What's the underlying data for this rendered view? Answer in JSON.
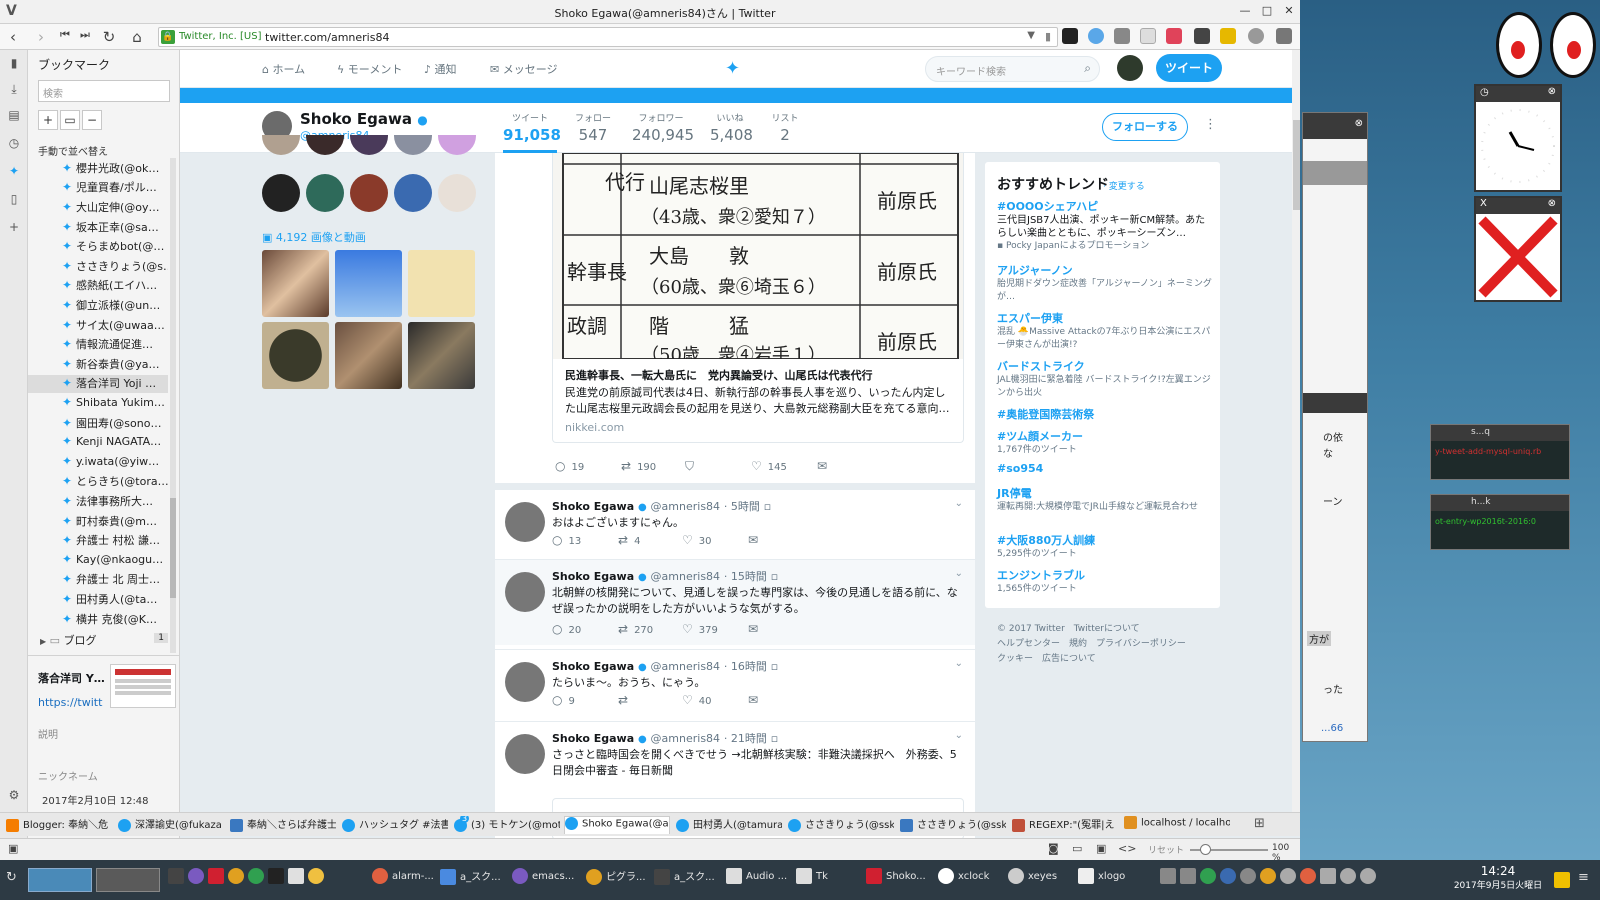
{
  "window": {
    "title": "Shoko Egawa(@amneris84)さん | Twitter"
  },
  "urlbar": {
    "cert": "Twitter, Inc. [US]",
    "url": "twitter.com/amneris84"
  },
  "bookmarks": {
    "heading": "ブックマーク",
    "search_placeholder": "検索",
    "sort_label": "手動で並べ替え",
    "items": [
      "櫻井光政(@ok…",
      "児童買春/ポル…",
      "大山定伸(@oy…",
      "坂本正幸(@sa…",
      "そらまめbot(@…",
      "ささきりょう(@s…",
      "感熱紙(エイハ…",
      "御立派様(@un…",
      "サイ太(@uwaa…",
      "情報流通促進…",
      "新谷泰貴(@ya…",
      "落合洋司 Yoji …",
      "Shibata Yukim…",
      "園田寿(@sono…",
      "Kenji NAGATA…",
      "y.iwata(@yiw…",
      "とらきち(@tora…",
      "法律事務所大…",
      "町村泰貴(@m…",
      "弁護士 村松 謙…",
      "Kay(@nkaogu…",
      "弁護士 北 周士…",
      "田村勇人(@ta…",
      "横井 克俊(@K…"
    ],
    "folder": "ブログ",
    "folder_count": "1",
    "detail_title": "落合洋司 Y…",
    "detail_url": "https://twitt",
    "detail_desc_label": "説明",
    "detail_nick_label": "ニックネーム",
    "detail_date": "2017年2月10日 12:48"
  },
  "twnav": {
    "home": "ホーム",
    "moments": "モーメント",
    "notifications": "通知",
    "messages": "メッセージ",
    "search_placeholder": "キーワード検索",
    "tweet_button": "ツイート"
  },
  "profile": {
    "name": "Shoko Egawa",
    "handle": "@amneris84",
    "stats": [
      {
        "label": "ツイート",
        "value": "91,058"
      },
      {
        "label": "フォロー",
        "value": "547"
      },
      {
        "label": "フォロワー",
        "value": "240,945"
      },
      {
        "label": "いいね",
        "value": "5,408"
      },
      {
        "label": "リスト",
        "value": "2"
      }
    ],
    "follow_button": "フォローする",
    "media_link": "4,192 画像と動画"
  },
  "card": {
    "table": [
      {
        "role": "代行",
        "person": "山尾志桜里",
        "detail": "（43歳、衆②愛知７）",
        "note": "前原氏"
      },
      {
        "role": "幹事長",
        "person": "大島　　敦",
        "detail": "（60歳、衆⑥埼玉６）",
        "note": "前原氏"
      },
      {
        "role": "政調",
        "person": "階　　　猛",
        "detail": "（50歳　衆④岩手１）",
        "note": "前原氏"
      }
    ],
    "title": "民進幹事長、一転大島氏に　党内異論受け、山尾氏は代表代行",
    "desc": "民進党の前原誠司代表は4日、新執行部の幹事長人事を巡り、いったん内定した山尾志桜里元政調会長の起用を見送り、大島敦元総務副大臣を充てる意向…",
    "url": "nikkei.com",
    "replies": "19",
    "retweets": "190",
    "likes": "145"
  },
  "tweets": [
    {
      "name": "Shoko Egawa",
      "handle": "@amneris84",
      "time": "· 5時間",
      "text": "おはよございますにゃん。",
      "replies": "13",
      "retweets": "4",
      "likes": "30"
    },
    {
      "name": "Shoko Egawa",
      "handle": "@amneris84",
      "time": "· 15時間",
      "text": "北朝鮮の核開発について、見通しを誤った専門家は、今後の見通しを語る前に、なぜ誤ったかの説明をした方がいいような気がする。",
      "replies": "20",
      "retweets": "270",
      "likes": "379"
    },
    {
      "name": "Shoko Egawa",
      "handle": "@amneris84",
      "time": "· 16時間",
      "text": "たらいま〜。おうち、にゃう。",
      "replies": "9",
      "retweets": "",
      "likes": "40"
    },
    {
      "name": "Shoko Egawa",
      "handle": "@amneris84",
      "time": "· 21時間",
      "text": "さっさと臨時国会を開くべきでせう →北朝鮮核実験：非難決議採択へ　外務委、5日閉会中審査 - 毎日新聞"
    }
  ],
  "trends": {
    "heading": "おすすめトレンド",
    "change": "· 変更する",
    "items": [
      {
        "name": "#OOOOシェアハピ",
        "desc": "三代目JSB7人出演、ポッキー新CM解禁。あたらしい楽曲とともに、ポッキーシーズン…",
        "promo": "Pocky Japanによるプロモーション"
      },
      {
        "name": "アルジャーノン",
        "desc": "胎児期ドダウン症改善「アルジャーノン」ネーミングが…"
      },
      {
        "name": "エスパー伊東",
        "desc": "混乱 🐣Massive Attackの7年ぶり日本公演にエスパー伊東さんが出演!?"
      },
      {
        "name": "バードストライク",
        "desc": "JAL機羽田に緊急着陸 バードストライク!?左翼エンジンから出火"
      },
      {
        "name": "#奥能登国際芸術祭",
        "desc": ""
      },
      {
        "name": "#ツム顔メーカー",
        "desc": "1,767件のツイート"
      },
      {
        "name": "#so954",
        "desc": ""
      },
      {
        "name": "JR停電",
        "desc": "運転再開:大規模停電でJR山手線など運転見合わせ"
      },
      {
        "name": "#大阪880万人訓練",
        "desc": "5,295件のツイート"
      },
      {
        "name": "エンジントラブル",
        "desc": "1,565件のツイート"
      }
    ]
  },
  "footer": {
    "line1": "© 2017 Twitter　Twitterについて",
    "line2": "ヘルプセンター　規約　プライバシーポリシー",
    "line3": "クッキー　広告について"
  },
  "tabs": [
    "Blogger: 奉納＼危",
    "深澤諭史(@fukaza",
    "奉納＼さらば弁護士",
    "ハッシュタグ #法書",
    "(3) モトケン(@moto",
    "Shoko Egawa(@am",
    "田村勇人(@tamura",
    "ささきりょう(@ssk_r",
    "ささきりょう(@ssk_r",
    "REGEXP:\"(冤罪|え",
    "localhost / localho"
  ],
  "tab_badge": "3",
  "statusbar": {
    "reset": "リセット",
    "zoom": "100 %"
  },
  "taskbar": {
    "items": [
      "alarm-...",
      "a_スク...",
      "emacs...",
      "ピグラ...",
      "a_スク...",
      "Audio ...",
      "Tk",
      "Shoko...",
      "xclock",
      "xeyes",
      "xlogo"
    ],
    "time": "14:24",
    "date": "2017年9月5日火曜日"
  },
  "desktop": {
    "term1": "s...q",
    "term1_text": "y-tweet-add-mysql-uniq.rb",
    "term2": "h...k",
    "term2_text": "ot-entry-wp2016t-2016:0",
    "bg_text1": "の依",
    "bg_text2": "な",
    "bg_text3": "ーン",
    "bg_text4": "方が",
    "bg_text5": "った",
    "bg_text6": "...66"
  },
  "colors": {
    "accent": "#1da1f2",
    "text": "#14171a",
    "muted": "#657786"
  }
}
